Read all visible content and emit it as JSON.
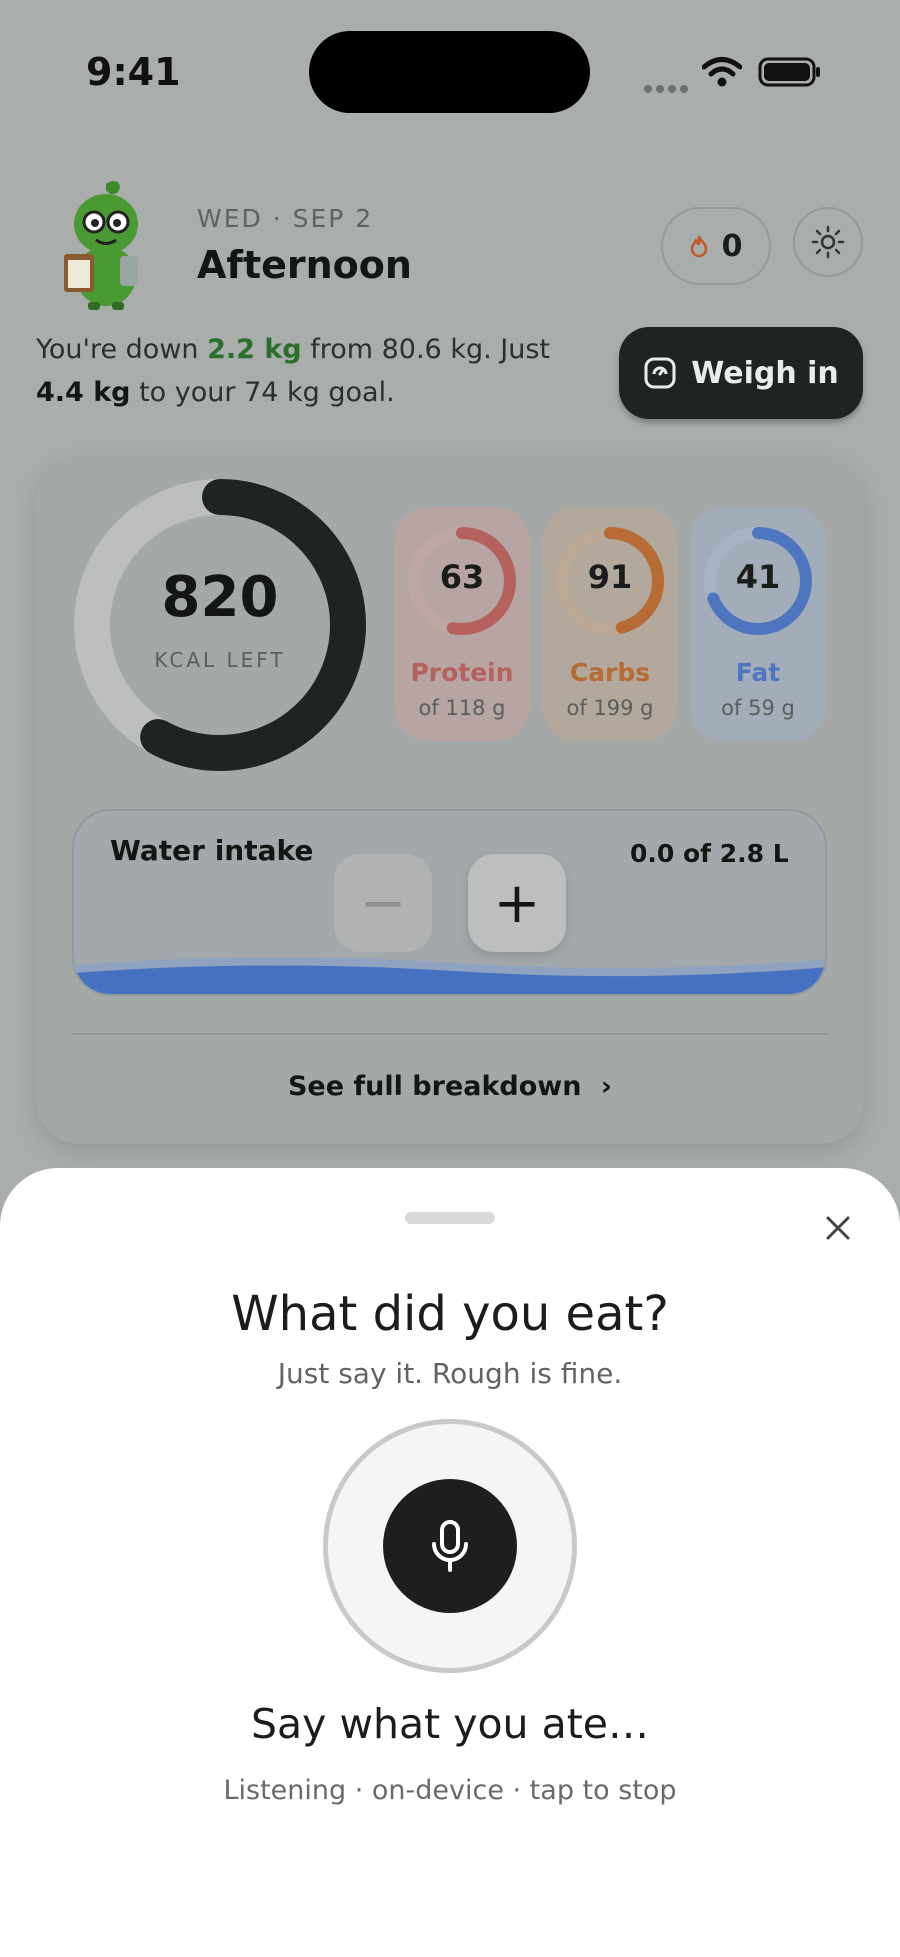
{
  "status_bar": {
    "time": "9:41"
  },
  "header": {
    "date": "WED · SEP 2",
    "greeting": "Afternoon",
    "streak_count": "0",
    "summary": {
      "prefix": "You're down ",
      "lost": "2.2 kg",
      "middle": " from 80.6 kg. Just ",
      "remaining": "4.4 kg",
      "suffix": " to your 74 kg goal."
    },
    "weigh_in_label": "Weigh in"
  },
  "calories": {
    "value": "820",
    "label": "KCAL LEFT",
    "progress": 0.58,
    "color": "#1f2321"
  },
  "macros": [
    {
      "value": "63",
      "name": "Protein",
      "target": "of 118 g",
      "progress": 0.53,
      "color": "#b5615d",
      "bg": "#b6a5a2",
      "track": "#bfa8a4"
    },
    {
      "value": "91",
      "name": "Carbs",
      "target": "of 199 g",
      "progress": 0.46,
      "color": "#b66c34",
      "bg": "#b3a89c",
      "track": "#bba895"
    },
    {
      "value": "41",
      "name": "Fat",
      "target": "of 59 g",
      "progress": 0.69,
      "color": "#4d76bf",
      "bg": "#a2adb9",
      "track": "#a6b3c3"
    }
  ],
  "water": {
    "title": "Water intake",
    "amount": "0.0 of 2.8 L",
    "minus_label": "−",
    "plus_label": "+"
  },
  "breakdown_label": "See full breakdown",
  "sheet": {
    "title": "What did you eat?",
    "subtitle": "Just say it. Rough is fine.",
    "prompt": "Say what you ate…",
    "status": "Listening · on-device · tap to stop"
  }
}
